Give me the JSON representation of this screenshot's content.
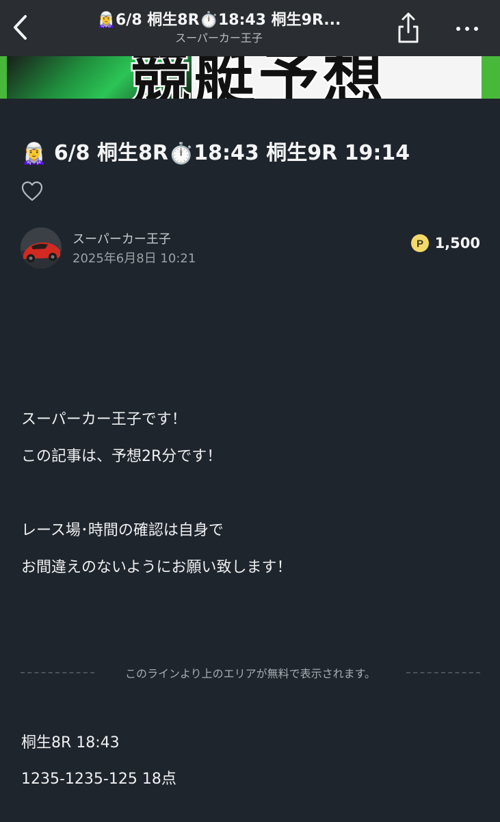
{
  "navbar": {
    "title": "🧝‍♀️6/8 桐生8R⏱️18:43 桐生9R...",
    "subtitle": "スーパーカー王子",
    "back_icon": "chevron-left-icon",
    "share_icon": "share-icon",
    "more_icon": "more-horizontal-icon"
  },
  "header_banner": {
    "text": "競艇予想"
  },
  "article": {
    "title_emoji_1": "🧝‍♀️",
    "title_part_1": "6/8 桐生8R",
    "title_emoji_2": "⏱️",
    "title_part_2": "18:43 桐生9R 19:14",
    "like_icon": "heart-outline-icon",
    "author": {
      "name": "スーパーカー王子",
      "date": "2025年6月8日 10:21"
    },
    "price": {
      "icon": "point-coin-icon",
      "coin_letter": "P",
      "value": "1,500"
    },
    "paragraphs": [
      "スーパーカー王子です！",
      "この記事は、予想2R分です！",
      "レース場･時間の確認は自身で",
      "お間違えのないようにお願い致します！"
    ],
    "paywall_notice": "このラインより上のエリアが無料で表示されます。",
    "paid_lines": [
      "桐生8R 18:43",
      "1235-1235-125 18点"
    ]
  },
  "colors": {
    "background": "#1f252c",
    "navbar": "#2a2d31",
    "accent_green": "#48b83a",
    "coin_yellow": "#f3d96a"
  }
}
